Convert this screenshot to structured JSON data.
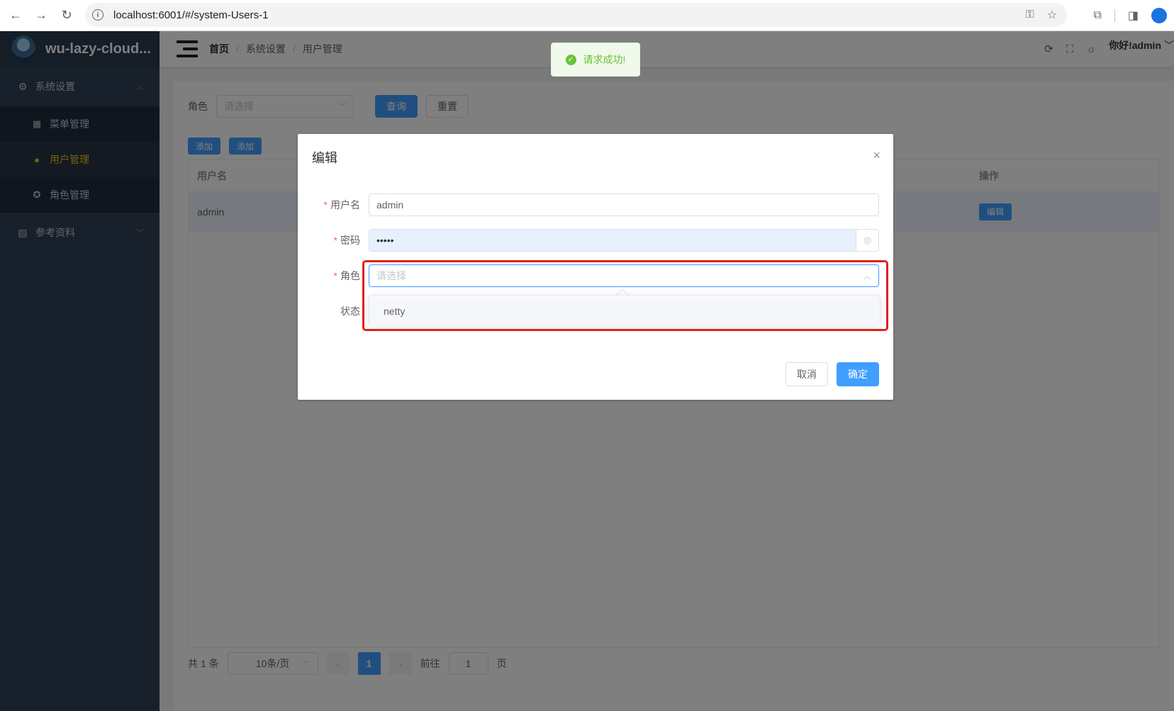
{
  "browser": {
    "url": "localhost:6001/#/system-Users-1",
    "back_icon": "←",
    "forward_icon": "→",
    "reload_icon": "↻",
    "info_icon": "i",
    "key_icon": "⚿",
    "star_icon": "☆",
    "extension_icon": "⧉",
    "sidepanel_icon": "◨",
    "profile_icon": "👤"
  },
  "app": {
    "name": "wu-lazy-cloud...",
    "sidebar": {
      "groups": [
        {
          "label": "系统设置",
          "icon": "⚙",
          "arrow": "︿"
        },
        {
          "label": "参考资料",
          "icon": "▤",
          "arrow": "﹀"
        }
      ],
      "items": [
        {
          "label": "菜单管理",
          "icon": "▦"
        },
        {
          "label": "用户管理",
          "icon": "●"
        },
        {
          "label": "角色管理",
          "icon": "✪"
        }
      ]
    },
    "breadcrumb": [
      "首页",
      "系统设置",
      "用户管理"
    ],
    "breadcrumb_sep": "/",
    "nav_icons": [
      "⟳",
      "⛶",
      "☼"
    ],
    "user_greeting": "你好!admin",
    "user_chevron": "﹀"
  },
  "search": {
    "role_label": "角色",
    "role_placeholder": "请选择",
    "query_label": "查询",
    "reset_label": "重置"
  },
  "toolbar": {
    "add_label_1": "添加",
    "add_label_2": "添加"
  },
  "table": {
    "headers": [
      "用户名",
      "操作"
    ],
    "rows": [
      {
        "username": "admin",
        "edit_label": "编辑"
      }
    ]
  },
  "pagination": {
    "total": "共 1 条",
    "page_size": "10条/页",
    "prev": "‹",
    "current_page": "1",
    "next": "›",
    "goto_label": "前往",
    "goto_value": "1",
    "page_suffix": "页"
  },
  "toast": {
    "message": "请求成功!",
    "icon": "✓"
  },
  "dialog": {
    "title": "编辑",
    "close_icon": "×",
    "fields": {
      "username_label": "用户名",
      "username_value": "admin",
      "password_label": "密码",
      "password_value": "•••••",
      "password_eye_icon": "◎",
      "role_label": "角色",
      "role_placeholder": "请选择",
      "status_label": "状态"
    },
    "required_mark": "*",
    "role_options": [
      "netty"
    ],
    "cancel_label": "取消",
    "confirm_label": "确定"
  },
  "colors": {
    "primary": "#409eff",
    "sidebar_bg": "#304156",
    "active_menu": "#f4bf1f",
    "success": "#67c23a",
    "highlight": "#e02020"
  }
}
